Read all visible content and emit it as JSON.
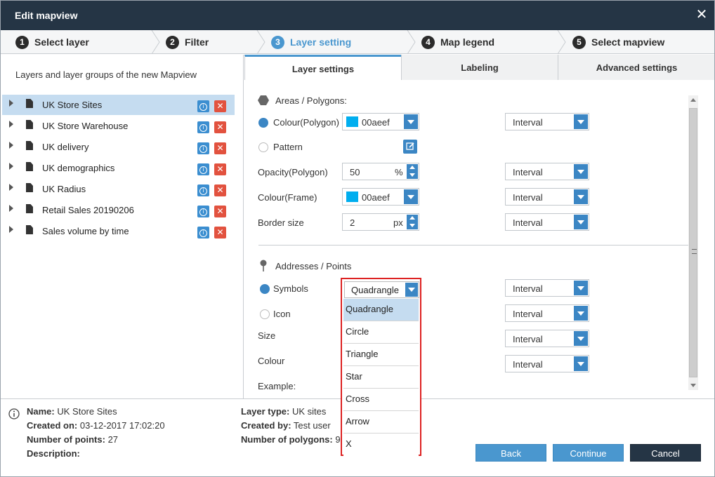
{
  "window": {
    "title": "Edit mapview"
  },
  "steps": [
    {
      "num": "1",
      "label": "Select layer"
    },
    {
      "num": "2",
      "label": "Filter"
    },
    {
      "num": "3",
      "label": "Layer setting"
    },
    {
      "num": "4",
      "label": "Map legend"
    },
    {
      "num": "5",
      "label": "Select mapview"
    }
  ],
  "active_step": 3,
  "sidebar": {
    "header": "Layers and layer groups of the new Mapview",
    "items": [
      {
        "label": "UK Store Sites"
      },
      {
        "label": "UK Store Warehouse"
      },
      {
        "label": "UK delivery"
      },
      {
        "label": "UK demographics"
      },
      {
        "label": "UK Radius"
      },
      {
        "label": "Retail Sales 20190206"
      },
      {
        "label": "Sales volume by time"
      }
    ]
  },
  "tabs": [
    {
      "label": "Layer settings"
    },
    {
      "label": "Labeling"
    },
    {
      "label": "Advanced settings"
    }
  ],
  "polygons": {
    "section": "Areas / Polygons:",
    "colour_label": "Colour(Polygon)",
    "colour_value": "00aeef",
    "pattern_label": "Pattern",
    "opacity_label": "Opacity(Polygon)",
    "opacity_value": "50",
    "opacity_unit": "%",
    "frame_label": "Colour(Frame)",
    "frame_value": "00aeef",
    "border_label": "Border size",
    "border_value": "2",
    "border_unit": "px",
    "interval": "Interval"
  },
  "points": {
    "section": "Addresses / Points",
    "symbols_label": "Symbols",
    "symbols_value": "Quadrangle",
    "icon_label": "Icon",
    "size_label": "Size",
    "colour_label": "Colour",
    "example_label": "Example:",
    "interval": "Interval"
  },
  "dropdown_options": [
    "Quadrangle",
    "Circle",
    "Triangle",
    "Star",
    "Cross",
    "Arrow",
    "X"
  ],
  "footer": {
    "name_k": "Name:",
    "name_v": "UK Store Sites",
    "created_k": "Created on:",
    "created_v": "03-12-2017 17:02:20",
    "points_k": "Number of points:",
    "points_v": "27",
    "desc_k": "Description:",
    "type_k": "Layer type:",
    "type_v": "UK sites",
    "by_k": "Created by:",
    "by_v": "Test user",
    "polys_k": "Number of polygons:",
    "polys_v": "9"
  },
  "buttons": {
    "back": "Back",
    "continue": "Continue",
    "cancel": "Cancel"
  },
  "colors": {
    "accent": "#4a97cf",
    "title_bar": "#253545",
    "swatch": "#00aeef",
    "delete": "#e2523f",
    "highlight_box": "#dd2222"
  }
}
